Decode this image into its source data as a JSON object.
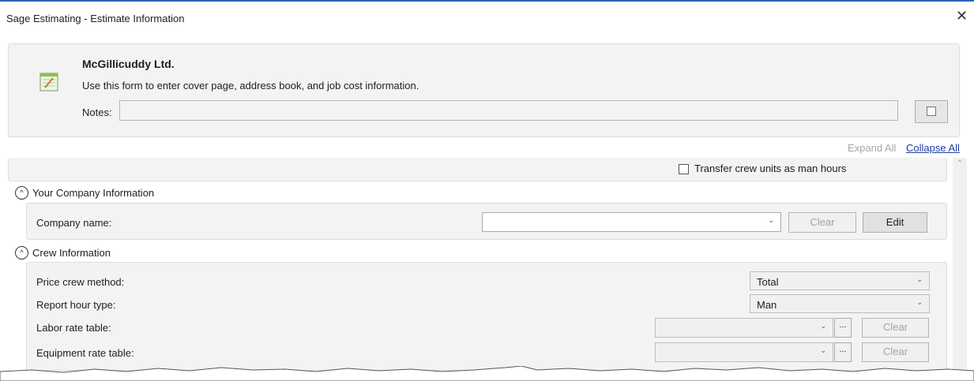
{
  "window": {
    "title": "Sage Estimating - Estimate Information",
    "close_glyph": "✕"
  },
  "header": {
    "company": "McGillicuddy Ltd.",
    "description": "Use this form to enter cover page, address book, and job cost information.",
    "notes_label": "Notes:",
    "notes_value": ""
  },
  "links": {
    "expand_all": "Expand All",
    "collapse_all": "Collapse All"
  },
  "transfer": {
    "label": "Transfer crew units as man hours",
    "checked": false
  },
  "company_section": {
    "title": "Your Company Information",
    "company_name_label": "Company name:",
    "company_name_value": "",
    "clear_label": "Clear",
    "edit_label": "Edit"
  },
  "crew_section": {
    "title": "Crew Information",
    "price_crew_method": {
      "label": "Price crew method:",
      "value": "Total"
    },
    "report_hour_type": {
      "label": "Report hour type:",
      "value": "Man"
    },
    "labor_rate_table": {
      "label": "Labor rate table:",
      "value": "",
      "dots": "...",
      "clear": "Clear"
    },
    "equipment_rate_table": {
      "label": "Equipment rate table:",
      "value": "",
      "dots": "...",
      "clear": "Clear"
    }
  }
}
